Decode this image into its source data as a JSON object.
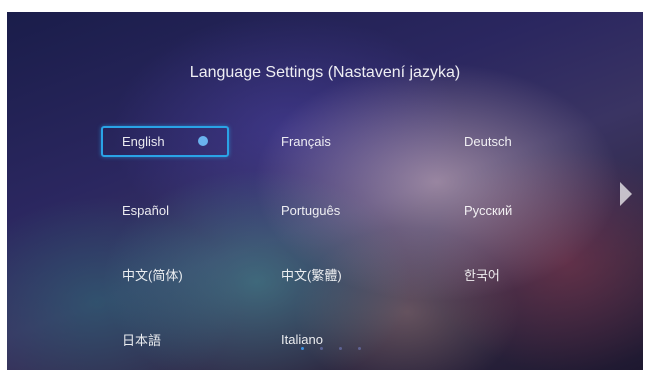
{
  "header": {
    "title": "Language Settings (Nastavení jazyka)"
  },
  "languages": [
    {
      "label": "English",
      "selected": true
    },
    {
      "label": "Français",
      "selected": false
    },
    {
      "label": "Deutsch",
      "selected": false
    },
    {
      "label": "Español",
      "selected": false
    },
    {
      "label": "Português",
      "selected": false
    },
    {
      "label": "Русский",
      "selected": false
    },
    {
      "label": "中文(简体)",
      "selected": false
    },
    {
      "label": "中文(繁體)",
      "selected": false
    },
    {
      "label": "한국어",
      "selected": false
    },
    {
      "label": "日本語",
      "selected": false
    },
    {
      "label": "Italiano",
      "selected": false
    }
  ],
  "pagination": {
    "pages": 4,
    "current": 1
  },
  "colors": {
    "accent": "#2aa3e6",
    "radio": "#6ab3ee",
    "active_dot": "#3b8fe0"
  },
  "icons": {
    "selected_indicator": "radio-selected-icon",
    "next_page": "next-page-arrow-icon"
  }
}
